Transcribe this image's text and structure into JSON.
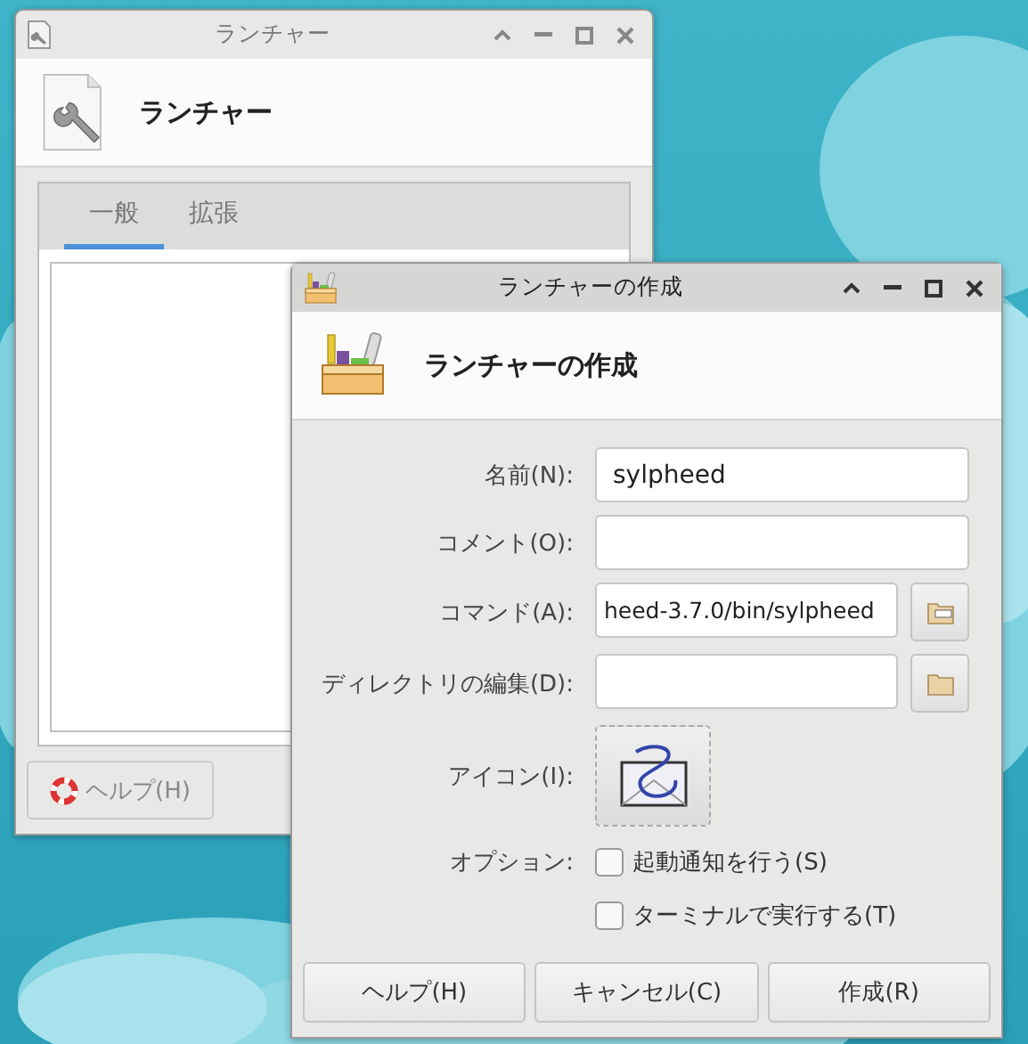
{
  "launcher_window": {
    "title": "ランチャー",
    "heading": "ランチャー",
    "tabs": [
      {
        "label": "一般",
        "selected": true
      },
      {
        "label": "拡張",
        "selected": false
      }
    ],
    "help_button": {
      "label": "ヘルプ(H)",
      "disabled": true
    }
  },
  "create_dialog": {
    "title": "ランチャーの作成",
    "heading": "ランチャーの作成",
    "fields": [
      {
        "label": "名前(N):",
        "value": "sylpheed",
        "kind": "text"
      },
      {
        "label": "コメント(O):",
        "kind": "text"
      },
      {
        "label": "コマンド(A):",
        "value": "heed-3.7.0/bin/sylpheed",
        "kind": "file"
      },
      {
        "label": "ディレクトリの編集(D):",
        "kind": "folder"
      },
      {
        "label": "アイコン(I):",
        "kind": "icon"
      }
    ],
    "options_label": "オプション:",
    "options": [
      {
        "label": "起動通知を行う(S)",
        "checked": false
      },
      {
        "label": "ターミナルで実行する(T)",
        "checked": false
      }
    ],
    "buttons": [
      "ヘルプ(H)",
      "キャンセル(C)",
      "作成(R)"
    ]
  }
}
